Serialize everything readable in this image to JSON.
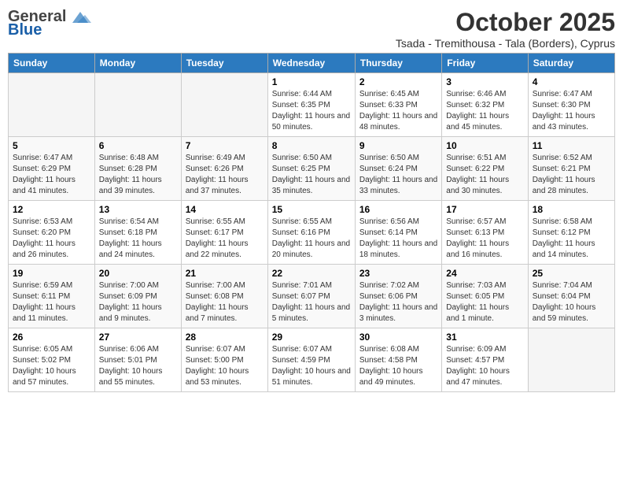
{
  "logo": {
    "general": "General",
    "blue": "Blue"
  },
  "title": "October 2025",
  "subtitle": "Tsada - Tremithousa - Tala (Borders), Cyprus",
  "days_of_week": [
    "Sunday",
    "Monday",
    "Tuesday",
    "Wednesday",
    "Thursday",
    "Friday",
    "Saturday"
  ],
  "weeks": [
    [
      {
        "day": "",
        "info": ""
      },
      {
        "day": "",
        "info": ""
      },
      {
        "day": "",
        "info": ""
      },
      {
        "day": "1",
        "info": "Sunrise: 6:44 AM\nSunset: 6:35 PM\nDaylight: 11 hours and 50 minutes."
      },
      {
        "day": "2",
        "info": "Sunrise: 6:45 AM\nSunset: 6:33 PM\nDaylight: 11 hours and 48 minutes."
      },
      {
        "day": "3",
        "info": "Sunrise: 6:46 AM\nSunset: 6:32 PM\nDaylight: 11 hours and 45 minutes."
      },
      {
        "day": "4",
        "info": "Sunrise: 6:47 AM\nSunset: 6:30 PM\nDaylight: 11 hours and 43 minutes."
      }
    ],
    [
      {
        "day": "5",
        "info": "Sunrise: 6:47 AM\nSunset: 6:29 PM\nDaylight: 11 hours and 41 minutes."
      },
      {
        "day": "6",
        "info": "Sunrise: 6:48 AM\nSunset: 6:28 PM\nDaylight: 11 hours and 39 minutes."
      },
      {
        "day": "7",
        "info": "Sunrise: 6:49 AM\nSunset: 6:26 PM\nDaylight: 11 hours and 37 minutes."
      },
      {
        "day": "8",
        "info": "Sunrise: 6:50 AM\nSunset: 6:25 PM\nDaylight: 11 hours and 35 minutes."
      },
      {
        "day": "9",
        "info": "Sunrise: 6:50 AM\nSunset: 6:24 PM\nDaylight: 11 hours and 33 minutes."
      },
      {
        "day": "10",
        "info": "Sunrise: 6:51 AM\nSunset: 6:22 PM\nDaylight: 11 hours and 30 minutes."
      },
      {
        "day": "11",
        "info": "Sunrise: 6:52 AM\nSunset: 6:21 PM\nDaylight: 11 hours and 28 minutes."
      }
    ],
    [
      {
        "day": "12",
        "info": "Sunrise: 6:53 AM\nSunset: 6:20 PM\nDaylight: 11 hours and 26 minutes."
      },
      {
        "day": "13",
        "info": "Sunrise: 6:54 AM\nSunset: 6:18 PM\nDaylight: 11 hours and 24 minutes."
      },
      {
        "day": "14",
        "info": "Sunrise: 6:55 AM\nSunset: 6:17 PM\nDaylight: 11 hours and 22 minutes."
      },
      {
        "day": "15",
        "info": "Sunrise: 6:55 AM\nSunset: 6:16 PM\nDaylight: 11 hours and 20 minutes."
      },
      {
        "day": "16",
        "info": "Sunrise: 6:56 AM\nSunset: 6:14 PM\nDaylight: 11 hours and 18 minutes."
      },
      {
        "day": "17",
        "info": "Sunrise: 6:57 AM\nSunset: 6:13 PM\nDaylight: 11 hours and 16 minutes."
      },
      {
        "day": "18",
        "info": "Sunrise: 6:58 AM\nSunset: 6:12 PM\nDaylight: 11 hours and 14 minutes."
      }
    ],
    [
      {
        "day": "19",
        "info": "Sunrise: 6:59 AM\nSunset: 6:11 PM\nDaylight: 11 hours and 11 minutes."
      },
      {
        "day": "20",
        "info": "Sunrise: 7:00 AM\nSunset: 6:09 PM\nDaylight: 11 hours and 9 minutes."
      },
      {
        "day": "21",
        "info": "Sunrise: 7:00 AM\nSunset: 6:08 PM\nDaylight: 11 hours and 7 minutes."
      },
      {
        "day": "22",
        "info": "Sunrise: 7:01 AM\nSunset: 6:07 PM\nDaylight: 11 hours and 5 minutes."
      },
      {
        "day": "23",
        "info": "Sunrise: 7:02 AM\nSunset: 6:06 PM\nDaylight: 11 hours and 3 minutes."
      },
      {
        "day": "24",
        "info": "Sunrise: 7:03 AM\nSunset: 6:05 PM\nDaylight: 11 hours and 1 minute."
      },
      {
        "day": "25",
        "info": "Sunrise: 7:04 AM\nSunset: 6:04 PM\nDaylight: 10 hours and 59 minutes."
      }
    ],
    [
      {
        "day": "26",
        "info": "Sunrise: 6:05 AM\nSunset: 5:02 PM\nDaylight: 10 hours and 57 minutes."
      },
      {
        "day": "27",
        "info": "Sunrise: 6:06 AM\nSunset: 5:01 PM\nDaylight: 10 hours and 55 minutes."
      },
      {
        "day": "28",
        "info": "Sunrise: 6:07 AM\nSunset: 5:00 PM\nDaylight: 10 hours and 53 minutes."
      },
      {
        "day": "29",
        "info": "Sunrise: 6:07 AM\nSunset: 4:59 PM\nDaylight: 10 hours and 51 minutes."
      },
      {
        "day": "30",
        "info": "Sunrise: 6:08 AM\nSunset: 4:58 PM\nDaylight: 10 hours and 49 minutes."
      },
      {
        "day": "31",
        "info": "Sunrise: 6:09 AM\nSunset: 4:57 PM\nDaylight: 10 hours and 47 minutes."
      },
      {
        "day": "",
        "info": ""
      }
    ]
  ]
}
